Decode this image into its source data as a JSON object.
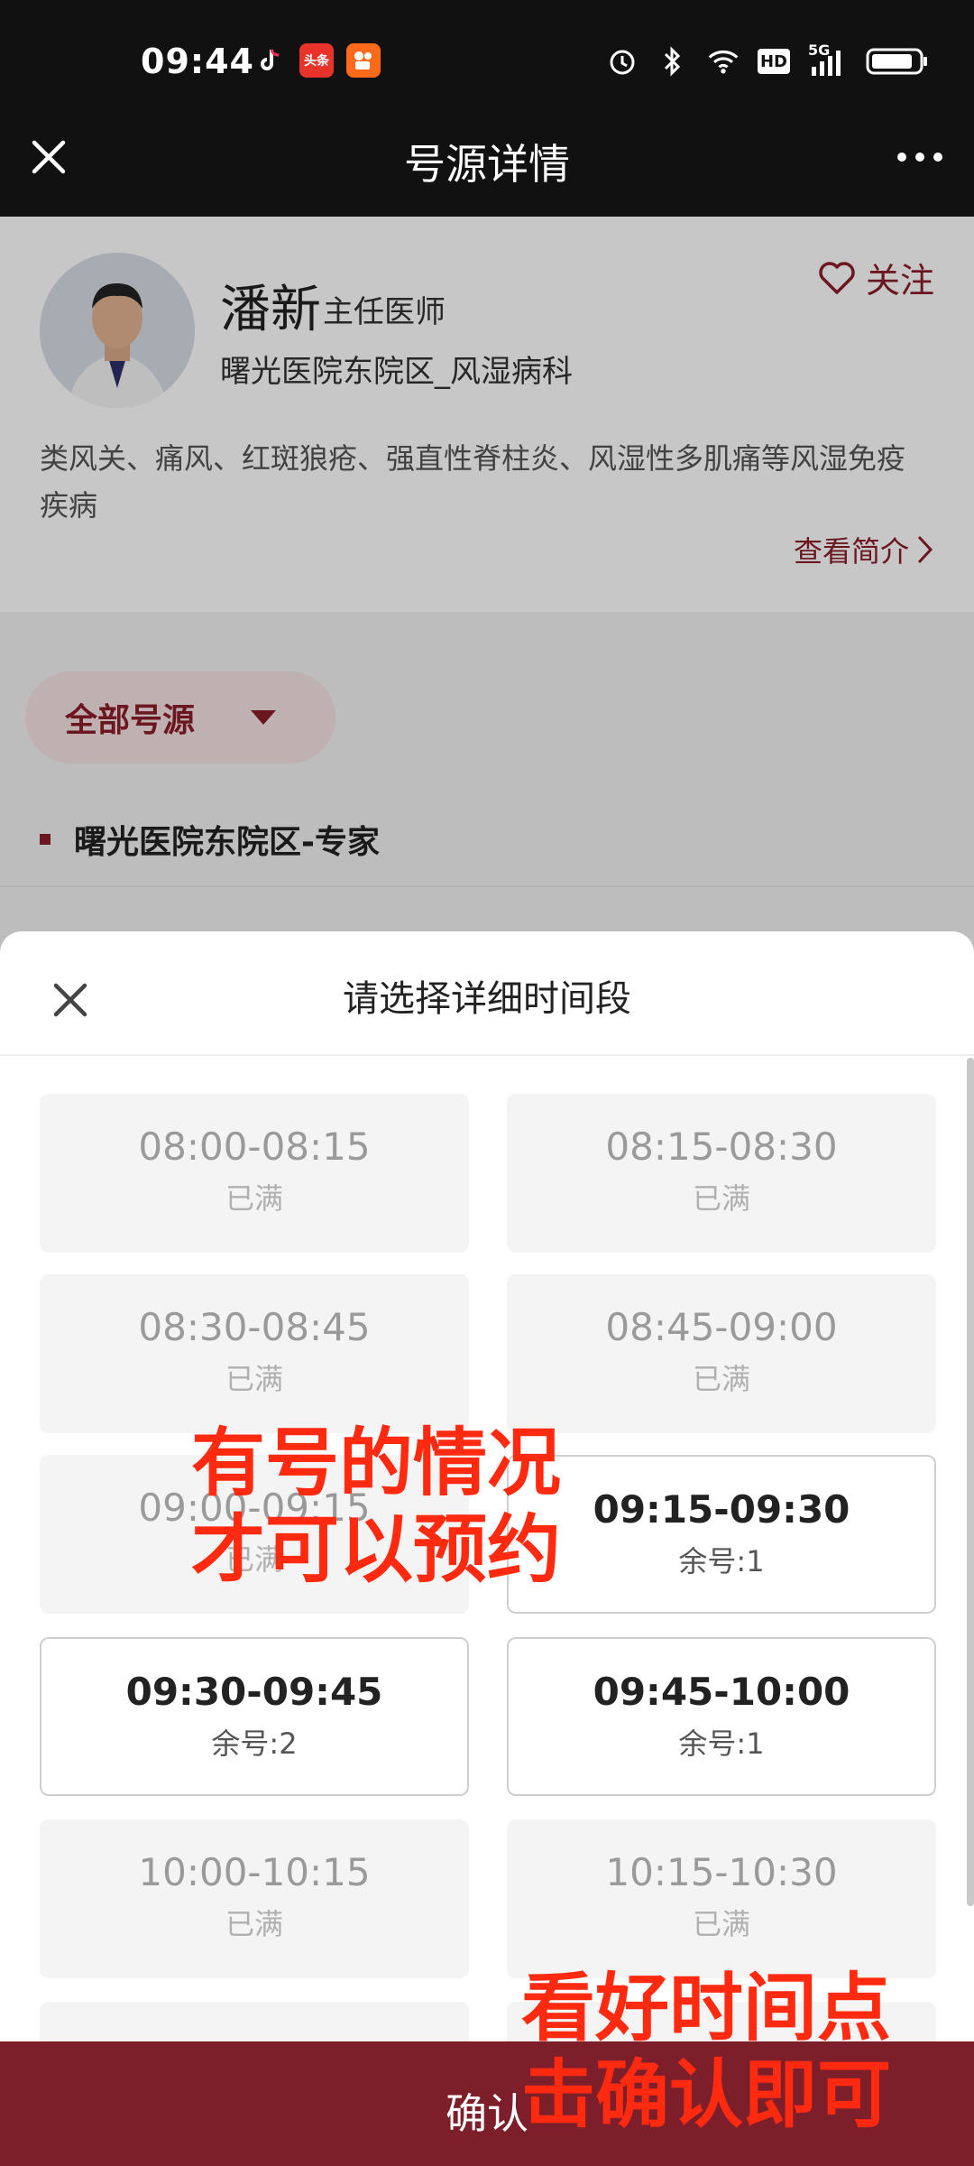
{
  "status_bar": {
    "time": "09:44",
    "apps": [
      "tiktok-icon",
      "toutiao-icon",
      "kuaishou-icon"
    ],
    "toutiao_text": "头条",
    "right_icons": [
      "alarm-icon",
      "bluetooth-icon",
      "wifi-icon",
      "hd-icon",
      "signal-5g-icon",
      "battery-icon"
    ],
    "hd_text": "HD",
    "net_text": "5G"
  },
  "header": {
    "title": "号源详情"
  },
  "doctor": {
    "name": "潘新",
    "title": "主任医师",
    "hospital": "曙光医院东院区_风湿病科",
    "follow_label": "关注",
    "description": "类风关、痛风、红斑狼疮、强直性脊柱炎、风湿性多肌痛等风湿免疫疾病",
    "intro_link": "查看简介"
  },
  "filter": {
    "label": "全部号源"
  },
  "location": {
    "label": "曙光医院东院区-专家"
  },
  "sheet": {
    "title": "请选择详细时间段",
    "slots": [
      {
        "time": "08:00-08:15",
        "status": "已满"
      },
      {
        "time": "08:15-08:30",
        "status": "已满"
      },
      {
        "time": "08:30-08:45",
        "status": "已满"
      },
      {
        "time": "08:45-09:00",
        "status": "已满"
      },
      {
        "time": "09:00-09:15",
        "status": "已满"
      },
      {
        "time": "09:15-09:30",
        "status": "余号:1"
      },
      {
        "time": "09:30-09:45",
        "status": "余号:2"
      },
      {
        "time": "09:45-10:00",
        "status": "余号:1"
      },
      {
        "time": "10:00-10:15",
        "status": "已满"
      },
      {
        "time": "10:15-10:30",
        "status": "已满"
      }
    ]
  },
  "annotations": {
    "note1_line1": "有号的情况",
    "note1_line2": "才可以预约",
    "note2_line1": "看好时间点",
    "note2_line2": "击确认即可"
  },
  "confirm": {
    "label": "确认"
  },
  "colors": {
    "brand": "#7d1f2a",
    "annotation": "#ff2a10"
  }
}
